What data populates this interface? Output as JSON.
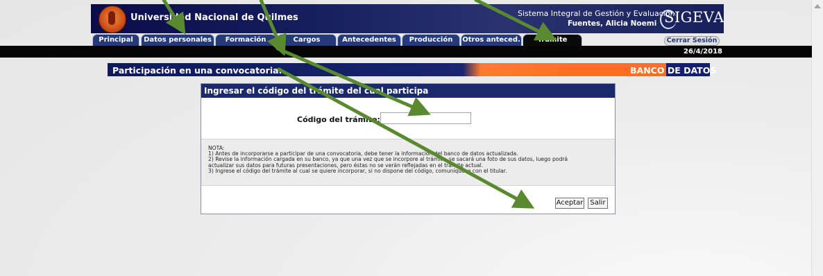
{
  "header": {
    "university": "Universidad Nacional de Quilmes",
    "system": "Sistema Integral de Gestión y Evaluación",
    "user": "Fuentes, Alicia Noemi",
    "brand": "SIGEVA",
    "logout": "Cerrar Sesión",
    "date": "26/4/2018"
  },
  "tabs": [
    {
      "label": "Principal"
    },
    {
      "label": "Datos personales"
    },
    {
      "label": "Formación"
    },
    {
      "label": "Cargos"
    },
    {
      "label": "Antecedentes"
    },
    {
      "label": "Producción"
    },
    {
      "label": "Otros anteced."
    },
    {
      "label": "Trámite",
      "active": true
    }
  ],
  "banner": {
    "title": "Participación en una convocatoria.",
    "right": "BANCO DE DATOS"
  },
  "dialog": {
    "title": "Ingresar el código del trámite del cual participa",
    "field_label": "Código del trámite:",
    "field_value": "",
    "note": [
      "NOTA:",
      "1) Antes de incorporarse a participar de una convocatoria, debe tener la información del banco de datos actualizada.",
      "2) Revise la información cargada en su banco, ya que una vez que se incorpore al trámite, se sacará una foto de sus datos, luego podrá",
      "actualizar sus datos para futuras presentaciones, pero éstas no se verán reflejadas en el trámite actual.",
      "3) Ingrese el código del trámite al cual se quiere incorporar, si no dispone del código, comuníquese con el titular."
    ],
    "accept": "Aceptar",
    "exit": "Salir"
  },
  "colors": {
    "header_navy": "#1a2a6c",
    "banner_orange": "#ff6e22",
    "annotation_arrow": "#5a8a2f"
  }
}
